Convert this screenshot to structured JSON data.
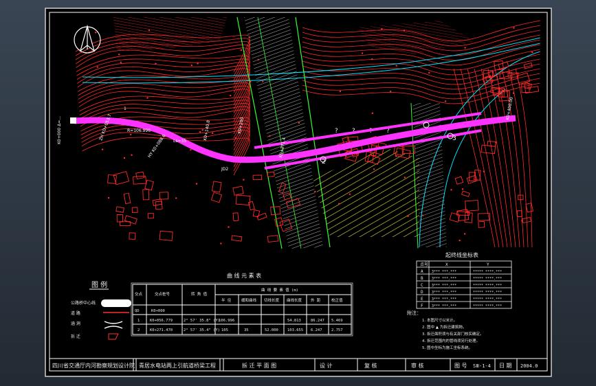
{
  "map": {
    "markers": [
      "2",
      "3"
    ]
  },
  "legend": {
    "title": "图 例",
    "items": [
      "公路桥中心线",
      "道 路",
      "涵 洞",
      "拆 迁"
    ]
  },
  "curve_table": {
    "title": "曲 线 元 素 表",
    "headers": [
      "交点",
      "交点桩号",
      "转 角 值",
      "曲 线 要 素 值 (m)"
    ],
    "sub_headers": [
      "半 径",
      "缓和曲线",
      "切线长度",
      "曲线长度",
      "外 距",
      "校正值"
    ],
    "rows": [
      [
        "QD",
        "K0+000"
      ],
      [
        "1",
        "K0+056.779",
        "2° 57' 35.8\" (Y)",
        "106.996",
        "",
        "54.813",
        "86.247",
        "5.469",
        "2.775"
      ],
      [
        "2",
        "K0+271.470",
        "2° 57' 35.4\" (Y)",
        "105",
        "35",
        "52.000",
        "103.655",
        "6.247",
        "2.757"
      ]
    ]
  },
  "coord_table": {
    "title": "起终线坐标表",
    "headers": [
      "点号",
      "X",
      "Y"
    ],
    "rows": [
      [
        "A",
        "3*** ***.***",
        "***** ****.***"
      ],
      [
        "B",
        "3*** ***.***",
        "***** ****.***"
      ],
      [
        "C",
        "3*** ***.***",
        "***** ****.***"
      ],
      [
        "D",
        "3*** ***.***",
        "***** ****.***"
      ],
      [
        "E",
        "3*** ***.***",
        "***** ****.***"
      ],
      [
        "F",
        "3*** ***.***",
        "***** ****.***"
      ]
    ]
  },
  "notes": {
    "title": "附注：",
    "lines": [
      "1. 本图尺寸以米计。",
      "2. 图中 ▲ 为拆迁建筑物。",
      "3. 拆迁面积须与有关部门核实确定。",
      "4. 拆迁范围内的管线须另行处理。",
      "5. 图中坐标为施工坐标系统。"
    ]
  },
  "title_block": {
    "institute": "四川省交通厅内河勘察规划设计院",
    "project": "青居水电站两上引航道桥梁工程",
    "drawing": "拆 迁 平 面 图",
    "design": "设 计",
    "review": "复 核",
    "check": "审 核",
    "drawing_no_label": "图 号",
    "drawing_no": "SⅢ-1-4",
    "date_label": "日 期",
    "date": "2004.0"
  },
  "colors": {
    "road_alignment": "#ff33ff",
    "terrain": "#ff2a2a",
    "river": "#33ff33",
    "road": "#00e5ff",
    "field": "#ffff44",
    "background": "#000000"
  }
}
